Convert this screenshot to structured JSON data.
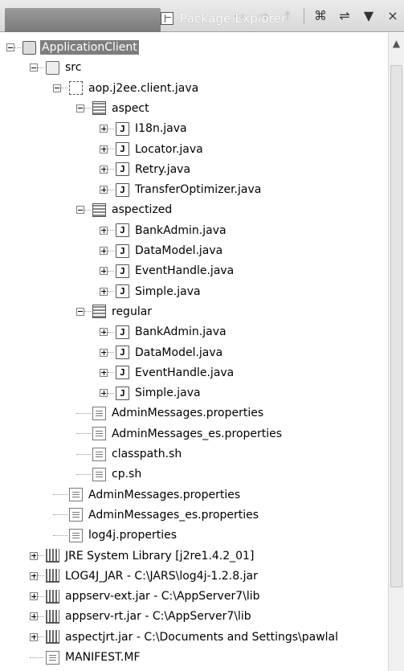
{
  "view": {
    "title": "Package Explorer",
    "toolbar": {
      "back": "⇦",
      "forward": "⇨",
      "up": "⤒",
      "collapse_all": "⌘",
      "link_editor": "⇌",
      "view_menu": "▼",
      "close": "×"
    }
  },
  "tree": [
    {
      "label": "ApplicationClient",
      "icon": "project-icon",
      "depth": 0,
      "expander": "minus",
      "selected": true
    },
    {
      "label": "src",
      "icon": "source-folder-icon",
      "depth": 1,
      "expander": "minus"
    },
    {
      "label": "aop.j2ee.client.java",
      "icon": "package-root-icon",
      "depth": 2,
      "expander": "minus"
    },
    {
      "label": "aspect",
      "icon": "package-icon",
      "depth": 3,
      "expander": "minus"
    },
    {
      "label": "I18n.java",
      "icon": "java-file-icon",
      "depth": 4,
      "expander": "plus"
    },
    {
      "label": "Locator.java",
      "icon": "java-file-icon",
      "depth": 4,
      "expander": "plus"
    },
    {
      "label": "Retry.java",
      "icon": "java-file-icon",
      "depth": 4,
      "expander": "plus"
    },
    {
      "label": "TransferOptimizer.java",
      "icon": "java-file-icon",
      "depth": 4,
      "expander": "plus"
    },
    {
      "label": "aspectized",
      "icon": "package-icon",
      "depth": 3,
      "expander": "minus"
    },
    {
      "label": "BankAdmin.java",
      "icon": "java-file-icon",
      "depth": 4,
      "expander": "plus"
    },
    {
      "label": "DataModel.java",
      "icon": "java-file-icon",
      "depth": 4,
      "expander": "plus"
    },
    {
      "label": "EventHandle.java",
      "icon": "java-file-icon",
      "depth": 4,
      "expander": "plus"
    },
    {
      "label": "Simple.java",
      "icon": "java-file-icon",
      "depth": 4,
      "expander": "plus"
    },
    {
      "label": "regular",
      "icon": "package-icon",
      "depth": 3,
      "expander": "minus"
    },
    {
      "label": "BankAdmin.java",
      "icon": "java-file-icon",
      "depth": 4,
      "expander": "plus"
    },
    {
      "label": "DataModel.java",
      "icon": "java-file-icon",
      "depth": 4,
      "expander": "plus"
    },
    {
      "label": "EventHandle.java",
      "icon": "java-file-icon",
      "depth": 4,
      "expander": "plus"
    },
    {
      "label": "Simple.java",
      "icon": "java-file-icon",
      "depth": 4,
      "expander": "plus"
    },
    {
      "label": "AdminMessages.properties",
      "icon": "text-file-icon",
      "depth": 3,
      "expander": "none"
    },
    {
      "label": "AdminMessages_es.properties",
      "icon": "text-file-icon",
      "depth": 3,
      "expander": "none"
    },
    {
      "label": "classpath.sh",
      "icon": "text-file-icon",
      "depth": 3,
      "expander": "none"
    },
    {
      "label": "cp.sh",
      "icon": "text-file-icon",
      "depth": 3,
      "expander": "none"
    },
    {
      "label": "AdminMessages.properties",
      "icon": "text-file-icon",
      "depth": 2,
      "expander": "none"
    },
    {
      "label": "AdminMessages_es.properties",
      "icon": "text-file-icon",
      "depth": 2,
      "expander": "none"
    },
    {
      "label": "log4j.properties",
      "icon": "text-file-icon",
      "depth": 2,
      "expander": "none"
    },
    {
      "label": "JRE System Library [j2re1.4.2_01]",
      "icon": "library-icon",
      "depth": 1,
      "expander": "plus"
    },
    {
      "label": "LOG4J_JAR - C:\\JARS\\log4j-1.2.8.jar",
      "icon": "jar-icon",
      "depth": 1,
      "expander": "plus"
    },
    {
      "label": "appserv-ext.jar - C:\\AppServer7\\lib",
      "icon": "jar-icon",
      "depth": 1,
      "expander": "plus"
    },
    {
      "label": "appserv-rt.jar - C:\\AppServer7\\lib",
      "icon": "jar-icon",
      "depth": 1,
      "expander": "plus"
    },
    {
      "label": "aspectjrt.jar - C:\\Documents and Settings\\pawlal",
      "icon": "jar-icon",
      "depth": 1,
      "expander": "plus"
    },
    {
      "label": "MANIFEST.MF",
      "icon": "text-file-icon",
      "depth": 1,
      "expander": "none"
    }
  ],
  "scrollbar": {
    "up_arrow": "▲",
    "position": 0.0
  }
}
